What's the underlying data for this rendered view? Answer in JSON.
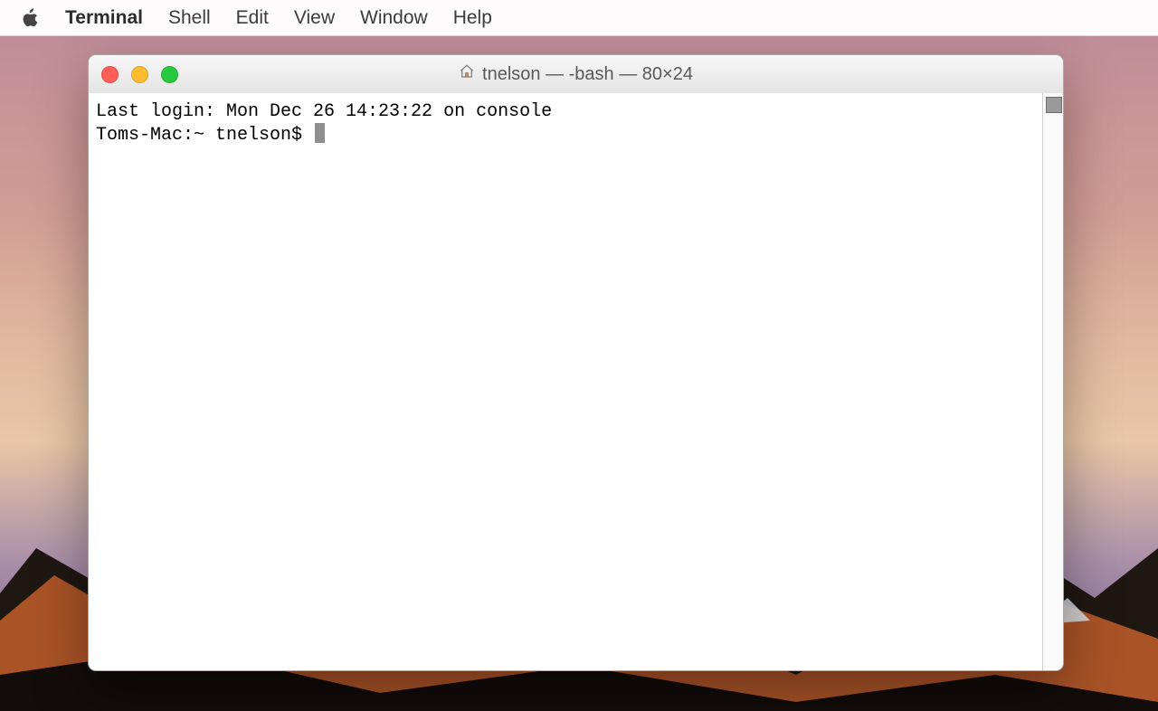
{
  "menubar": {
    "app": "Terminal",
    "items": [
      "Shell",
      "Edit",
      "View",
      "Window",
      "Help"
    ]
  },
  "window": {
    "title": "tnelson — -bash — 80×24"
  },
  "terminal": {
    "last_login": "Last login: Mon Dec 26 14:23:22 on console",
    "prompt": "Toms-Mac:~ tnelson$ "
  }
}
